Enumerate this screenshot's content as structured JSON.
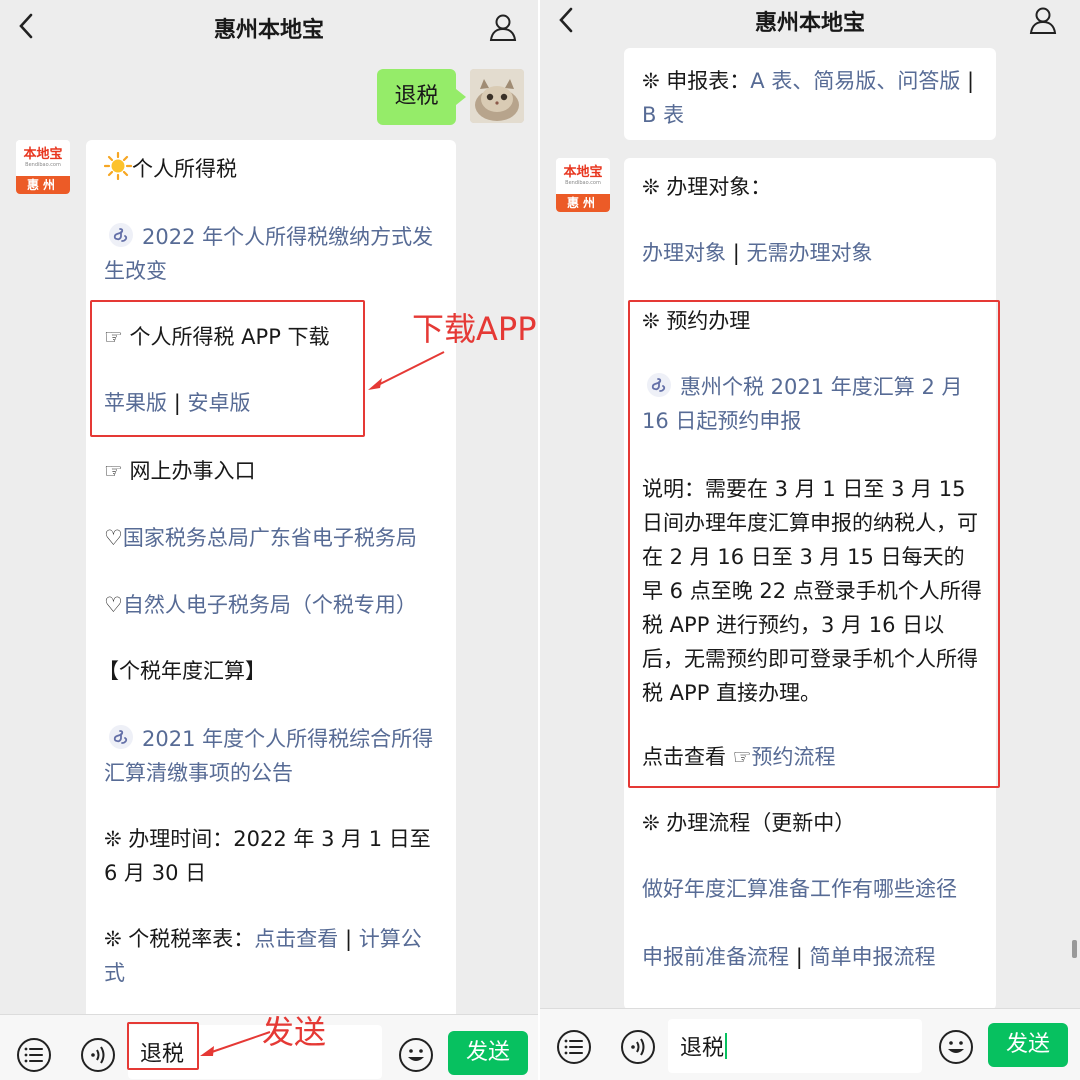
{
  "app": {
    "title": "惠州本地宝"
  },
  "avatar_logo": {
    "brand": "本地宝",
    "brand_en": "Bendibao.com",
    "city": "惠州"
  },
  "left": {
    "user_message": "退税",
    "card": {
      "heading": "个人所得税",
      "mini_link_1": "2022 年个人所得税缴纳方式发生改变",
      "app_download_title": "☞ 个人所得税 APP 下载",
      "ios": "苹果版",
      "sep": "|",
      "android": "安卓版",
      "online_title": "☞ 网上办事入口",
      "link_guangdong": "国家税务总局广东省电子税务局",
      "link_natural": "自然人电子税务局（个税专用）",
      "heart": "♡",
      "annual_title": "【个税年度汇算】",
      "mini_link_2": "2021 年度个人所得税综合所得汇算清缴事项的公告",
      "time_text": "❊ 办理时间：2022 年 3 月 1 日至 6 月 30 日",
      "rate_label": "❊ 个税税率表：",
      "rate_view": "点击查看",
      "rate_formula": "计算公式"
    },
    "annot_download": "下载APP",
    "annot_send": "发送",
    "input_value": "退税",
    "send_label": "发送"
  },
  "right": {
    "card1": {
      "label": "❊ 申报表：",
      "a": "A 表、简易版、问答版",
      "sep": "|",
      "b": "B 表"
    },
    "card2": {
      "target_title": "❊ 办理对象：",
      "target_link": "办理对象",
      "sep": "|",
      "no_target_link": "无需办理对象",
      "reserve_title": "❊ 预约办理",
      "mini_link": "惠州个税 2021 年度汇算 2 月 16 日起预约申报",
      "note": "说明：需要在 3 月 1 日至 3 月 15 日间办理年度汇算申报的纳税人，可在 2 月 16 日至 3 月 15 日每天的早 6 点至晚 22 点登录手机个人所得税 APP 进行预约，3 月 16 日以后，无需预约即可登录手机个人所得税 APP 直接办理。",
      "view_prefix": "点击查看 ☞",
      "view_link": "预约流程",
      "process_title": "❊ 办理流程（更新中）",
      "process_link_1": "做好年度汇算准备工作有哪些途径",
      "process_link_2a": "申报前准备流程",
      "process_link_2b": "简单申报流程"
    },
    "input_value": "退税",
    "send_label": "发送"
  },
  "colors": {
    "link": "#576b95",
    "send": "#07c160",
    "bubble": "#95ec69",
    "annotation": "#e53935"
  }
}
